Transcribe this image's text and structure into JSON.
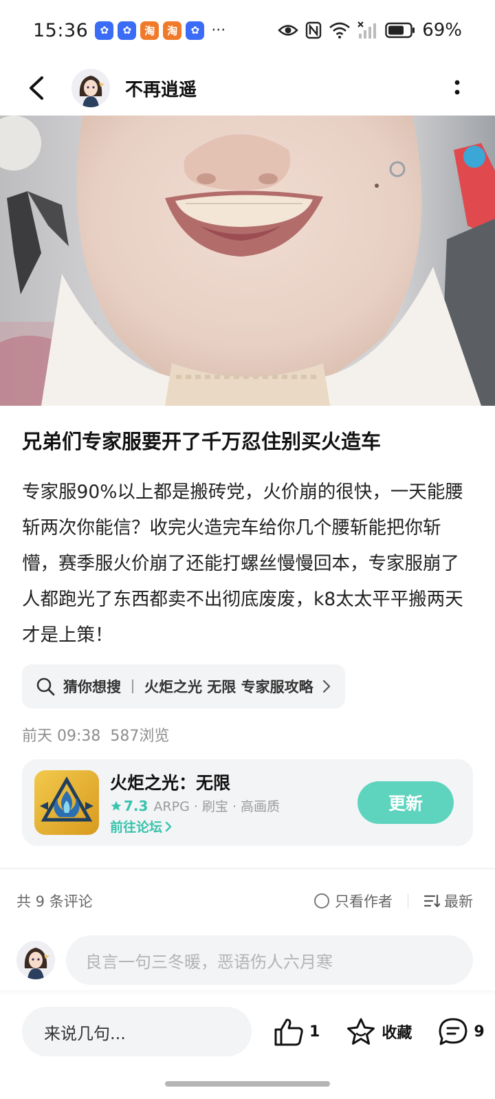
{
  "status_bar": {
    "time": "15:36",
    "notifications": [
      {
        "icon": "app-blue-icon",
        "glyph": "✿",
        "color": "#3b6cf5"
      },
      {
        "icon": "app-blue-icon",
        "glyph": "✿",
        "color": "#3b6cf5"
      },
      {
        "icon": "taobao-icon",
        "glyph": "淘",
        "color": "#f07a2a"
      },
      {
        "icon": "taobao-icon",
        "glyph": "淘",
        "color": "#f07a2a"
      },
      {
        "icon": "app-blue-icon",
        "glyph": "✿",
        "color": "#3b6cf5"
      }
    ],
    "more": "···",
    "battery": "69%"
  },
  "nav": {
    "author_name": "不再逍遥"
  },
  "post": {
    "title": "兄弟们专家服要开了千万忍住别买火造车",
    "body": "专家服90%以上都是搬砖党，火价崩的很快，一天能腰斩两次你能信？收完火造完车给你几个腰斩能把你斩懵，赛季服火价崩了还能打螺丝慢慢回本，专家服崩了人都跑光了东西都卖不出彻底废废，k8太太平平搬两天才是上策！",
    "suggest_title": "猜你想搜",
    "suggest_query": "火炬之光 无限 专家服攻略",
    "time": "前天 09:38",
    "views": "587浏览"
  },
  "game": {
    "name": "火炬之光：无限",
    "rating": "7.3",
    "tags": "ARPG · 刷宝 · 高画质",
    "forum_link": "前往论坛",
    "update_label": "更新",
    "accent": "#39c3ad"
  },
  "comments": {
    "count_label": "共 9 条评论",
    "author_only": "只看作者",
    "sort_label": "最新",
    "input_placeholder": "良言一句三冬暖，恶语伤人六月寒"
  },
  "actions": {
    "say_placeholder": "来说几句...",
    "likes": "1",
    "favorite_label": "收藏",
    "comment_count": "9"
  }
}
